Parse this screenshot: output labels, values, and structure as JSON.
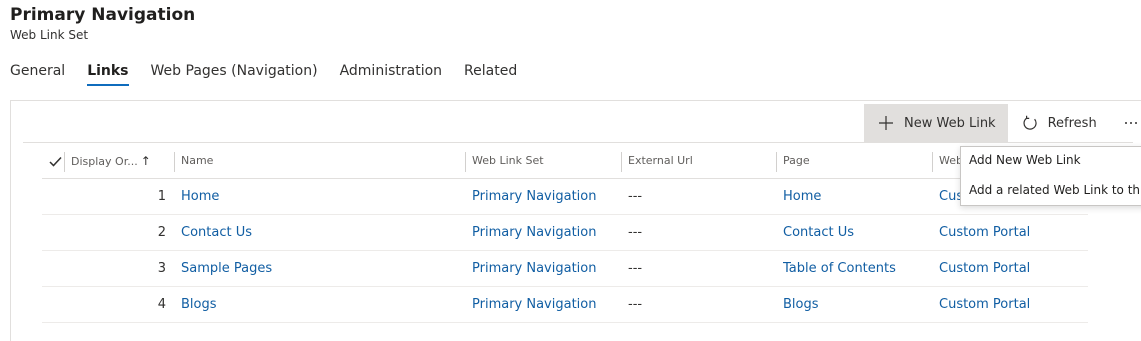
{
  "record": {
    "title": "Primary Navigation",
    "subtitle": "Web Link Set"
  },
  "tabs": [
    {
      "label": "General",
      "active": false
    },
    {
      "label": "Links",
      "active": true
    },
    {
      "label": "Web Pages (Navigation)",
      "active": false
    },
    {
      "label": "Administration",
      "active": false
    },
    {
      "label": "Related",
      "active": false
    }
  ],
  "command_bar": {
    "new_label": "New Web Link",
    "new_icon": "plus-icon",
    "refresh_label": "Refresh",
    "refresh_icon": "refresh-icon",
    "more_icon": "more-icon"
  },
  "grid": {
    "columns": {
      "display_order": "Display Or...",
      "name": "Name",
      "web_link_set": "Web Link Set",
      "external_url": "External Url",
      "page": "Page",
      "website": "Web"
    },
    "sort_indicator": "↑",
    "rows": [
      {
        "order": "1",
        "name": "Home",
        "web_link_set": "Primary Navigation",
        "external_url": "---",
        "page": "Home",
        "website": "Cust"
      },
      {
        "order": "2",
        "name": "Contact Us",
        "web_link_set": "Primary Navigation",
        "external_url": "---",
        "page": "Contact Us",
        "website": "Custom Portal"
      },
      {
        "order": "3",
        "name": "Sample Pages",
        "web_link_set": "Primary Navigation",
        "external_url": "---",
        "page": "Table of Contents",
        "website": "Custom Portal"
      },
      {
        "order": "4",
        "name": "Blogs",
        "web_link_set": "Primary Navigation",
        "external_url": "---",
        "page": "Blogs",
        "website": "Custom Portal"
      }
    ]
  },
  "dropdown": {
    "items": [
      {
        "label": "Add New Web Link"
      },
      {
        "label": "Add a related Web Link to this re"
      }
    ]
  },
  "colors": {
    "accent": "#0f6cbd",
    "link": "#115ea3",
    "pressed_bg": "#e1dfdd"
  }
}
